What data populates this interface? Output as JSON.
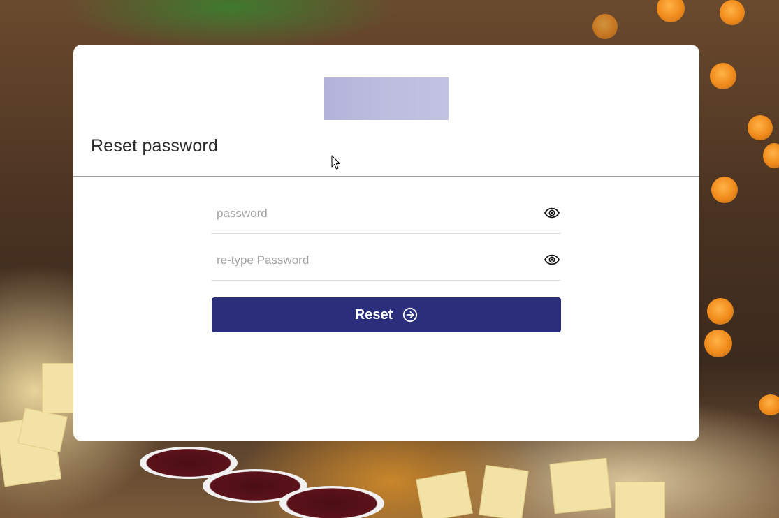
{
  "page": {
    "title": "Reset password"
  },
  "logo": {
    "color": "#b9b9de"
  },
  "form": {
    "password_placeholder": "password",
    "password_value": "",
    "retype_placeholder": "re-type Password",
    "retype_value": "",
    "show_password_icon": "eye-icon",
    "reset_label": "Reset",
    "reset_icon": "arrow-circle-right-icon"
  },
  "colors": {
    "button_bg": "#2b2e7a",
    "button_text": "#ffffff",
    "card_bg": "#ffffff"
  }
}
